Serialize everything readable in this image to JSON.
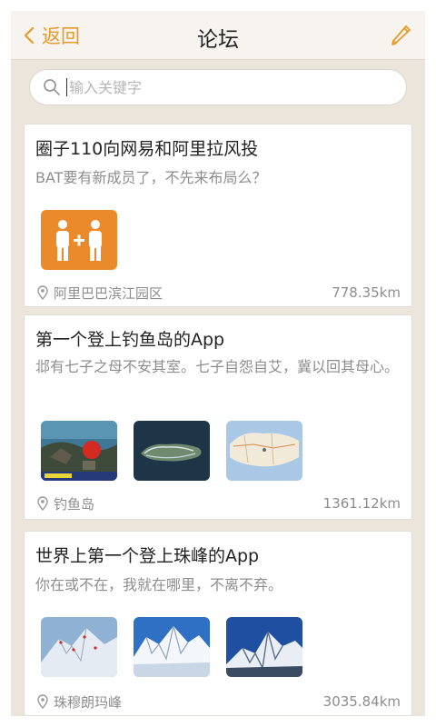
{
  "nav": {
    "back_label": "返回",
    "title": "论坛"
  },
  "search": {
    "placeholder": "输入关键字",
    "value": ""
  },
  "posts": [
    {
      "title": "圈子110向网易和阿里拉风投",
      "desc": "BAT要有新成员了，不先来布局么？",
      "location": "阿里巴巴滨江园区",
      "distance": "778.35km"
    },
    {
      "title": "第一个登上钓鱼岛的App",
      "desc": "邶有七子之母不安其室。七子自怨自艾，冀以回其母心。",
      "location": "钓鱼岛",
      "distance": "1361.12km"
    },
    {
      "title": "世界上第一个登上珠峰的App",
      "desc": "你在或不在，我就在哪里，不离不弃。",
      "location": "珠穆朗玛峰",
      "distance": "3035.84km"
    }
  ],
  "colors": {
    "accent": "#e79a2a",
    "background": "#ebe5dc",
    "card": "#ffffff",
    "muted_text": "#8d8d8d"
  },
  "icons": [
    "chevron-left-icon",
    "pencil-icon",
    "search-icon",
    "location-pin-icon"
  ]
}
